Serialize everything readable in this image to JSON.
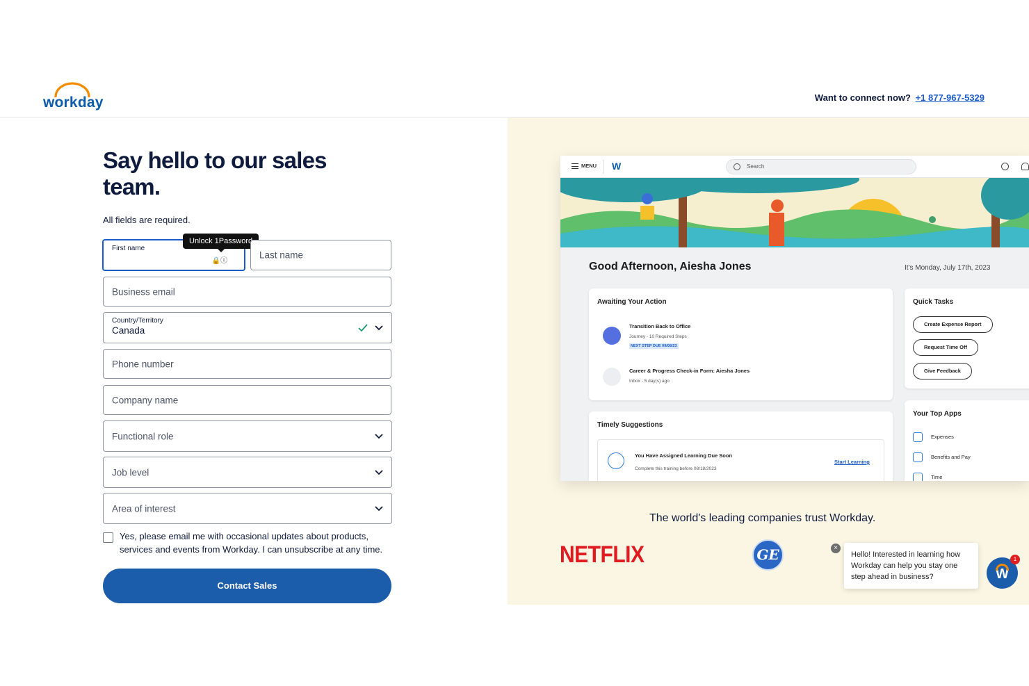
{
  "header": {
    "logo_text": "workday",
    "connect_label": "Want to connect now?",
    "phone": "+1 877-967-5329"
  },
  "form": {
    "title": "Say hello to our sales team.",
    "required_note": "All fields are required.",
    "first_name_label": "First name",
    "onepassword_tooltip": "Unlock 1Password",
    "last_name_placeholder": "Last name",
    "email_placeholder": "Business email",
    "country_label": "Country/Territory",
    "country_value": "Canada",
    "phone_placeholder": "Phone number",
    "company_placeholder": "Company name",
    "role_placeholder": "Functional role",
    "level_placeholder": "Job level",
    "interest_placeholder": "Area of interest",
    "consent_text": "Yes, please email me with occasional updates about products, services and events from Workday. I can unsubscribe at any time.",
    "submit_label": "Contact Sales"
  },
  "app": {
    "menu_label": "MENU",
    "logo": "W",
    "search_placeholder": "Search",
    "greeting": "Good Afternoon, Aiesha Jones",
    "date": "It's Monday, July 17th, 2023",
    "awaiting": {
      "title": "Awaiting Your Action",
      "items": [
        {
          "title": "Transition Back to Office",
          "sub": "Journey - 10 Required Steps",
          "badge": "NEXT STEP DUE 09/08/23"
        },
        {
          "title": "Career & Progress Check-in Form: Aiesha Jones",
          "sub": "Inbox - 5 day(s) ago"
        }
      ]
    },
    "quick_tasks": {
      "title": "Quick Tasks",
      "buttons": [
        "Create Expense Report",
        "Request Time Off",
        "Give Feedback"
      ]
    },
    "suggestions": {
      "title": "Timely Suggestions",
      "item_title": "You Have Assigned Learning Due Soon",
      "item_sub": "Complete this training before 08/18/2023",
      "link": "Start Learning"
    },
    "top_apps": {
      "title": "Your Top Apps",
      "items": [
        "Expenses",
        "Benefits and Pay",
        "Time"
      ]
    }
  },
  "promo": {
    "trust_text": "The world's leading companies trust Workday.",
    "netflix": "NETFLIX",
    "ge": "GE"
  },
  "chat": {
    "message": "Hello! Interested in learning how Workday can help you stay one step ahead in business?",
    "close": "×",
    "fab_letter": "W",
    "badge_count": "1"
  },
  "colors": {
    "brand_blue": "#1b5cab",
    "accent_orange": "#f38b00",
    "promo_bg": "#fbf6e4"
  }
}
